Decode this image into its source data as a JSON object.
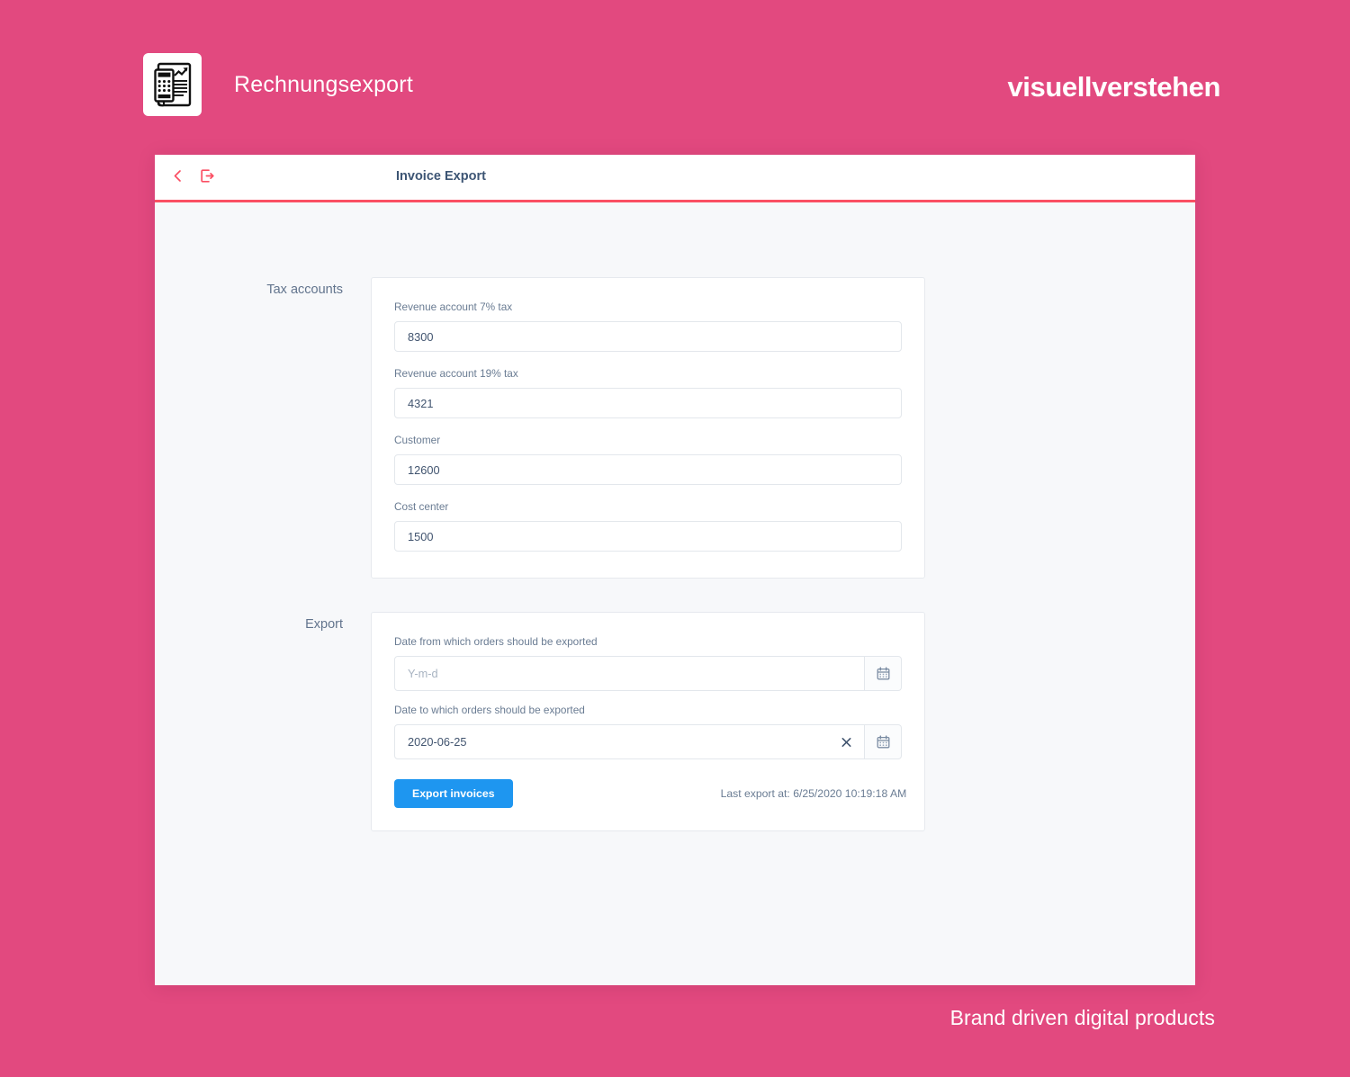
{
  "page": {
    "background_color": "#e2497f",
    "title": "Rechnungsexport",
    "logo_icon": "invoice-calculator-icon",
    "brand": "visuellverstehen",
    "footer_tagline": "Brand driven digital products"
  },
  "window": {
    "title": "Invoice Export",
    "accent_color": "#fb4f63",
    "back_icon": "chevron-left-icon",
    "export_icon": "sign-out-icon"
  },
  "sections": [
    {
      "label": "Tax accounts",
      "fields": [
        {
          "label": "Revenue account 7% tax",
          "value": "8300"
        },
        {
          "label": "Revenue account 19% tax",
          "value": "4321"
        },
        {
          "label": "Customer",
          "value": "12600"
        },
        {
          "label": "Cost center",
          "value": "1500"
        }
      ]
    },
    {
      "label": "Export",
      "date_from": {
        "label": "Date from which orders should be exported",
        "value": "",
        "placeholder": "Y-m-d",
        "calendar_icon": "calendar-icon"
      },
      "date_to": {
        "label": "Date to which orders should be exported",
        "value": "2020-06-25",
        "placeholder": "Y-m-d",
        "clear_icon": "clear-icon",
        "calendar_icon": "calendar-icon"
      },
      "export_button": "Export invoices",
      "export_button_color": "#1e96f0",
      "last_export": "Last export at: 6/25/2020 10:19:18 AM"
    }
  ]
}
